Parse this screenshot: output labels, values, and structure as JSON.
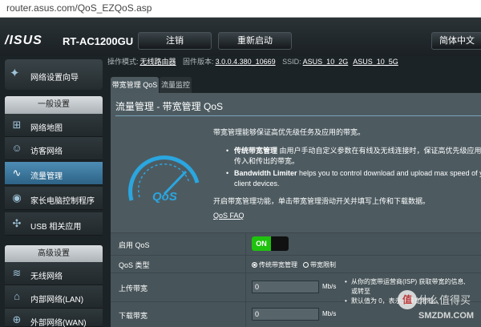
{
  "browser": {
    "url": "router.asus.com/QoS_EZQoS.asp"
  },
  "header": {
    "logo": "/ISUS",
    "model": "RT-AC1200GU",
    "logout_label": "注销",
    "reboot_label": "重新启动",
    "language_label": "简体中文"
  },
  "info": {
    "mode_label": "操作模式:",
    "mode_value": "无线路由器",
    "firmware_label": "固件版本:",
    "firmware_value": "3.0.0.4.380_10669",
    "ssid_label": "SSID:",
    "ssid_1": "ASUS_10_2G",
    "ssid_2": "ASUS_10_5G"
  },
  "sidebar": {
    "quick_setup": "网络设置向导",
    "general_header": "一般设置",
    "items": [
      {
        "label": "网络地图",
        "icon": "network-map-icon"
      },
      {
        "label": "访客网络",
        "icon": "guest-network-icon"
      },
      {
        "label": "流量管理",
        "icon": "traffic-manager-icon",
        "active": true
      },
      {
        "label": "家长电脑控制程序",
        "icon": "parental-control-icon"
      },
      {
        "label": "USB 相关应用",
        "icon": "usb-icon"
      }
    ],
    "advanced_header": "高级设置",
    "advanced_items": [
      {
        "label": "无线网络",
        "icon": "wireless-icon"
      },
      {
        "label": "内部网络(LAN)",
        "icon": "lan-icon"
      },
      {
        "label": "外部网络(WAN)",
        "icon": "wan-icon"
      }
    ]
  },
  "tabs": [
    "带宽管理 QoS",
    "流量监控"
  ],
  "main": {
    "title": "流量管理 - 带宽管理 QoS",
    "intro": "带宽管理能够保证高优先级任务及应用的带宽。",
    "bullet1_title": "传统带宽管理",
    "bullet1_text": " 由用户手动自定义参数在有线及无线连接时，保证高优先级应用及程",
    "bullet1_text2": "传入和传出的带宽。",
    "bullet2_title": "Bandwidth Limiter",
    "bullet2_text": " helps you to control download and upload max speed of you",
    "bullet2_text2": "client devices.",
    "hint": "开启带宽管理功能，单击带宽管理滑动开关并填写上传和下载数据。",
    "faq": "QoS FAQ",
    "gauge_text": "QoS"
  },
  "form": {
    "enable_label": "启用 QoS",
    "toggle_on": "ON",
    "type_label": "QoS 类型",
    "type_options": [
      "传统带宽管理",
      "带宽限制"
    ],
    "type_selected": 0,
    "upload_label": "上传带宽",
    "upload_value": "0",
    "download_label": "下载带宽",
    "download_value": "0",
    "unit": "Mb/s",
    "note_line1": "从你的宽带运营商(ISP) 获取带宽的信息,",
    "note_line2": "或转至",
    "note_line3": "默认值为 0，表示无带宽限制。"
  },
  "watermark": {
    "badge": "值",
    "line1": "什么值得买",
    "line2": "SMZDM.COM"
  }
}
